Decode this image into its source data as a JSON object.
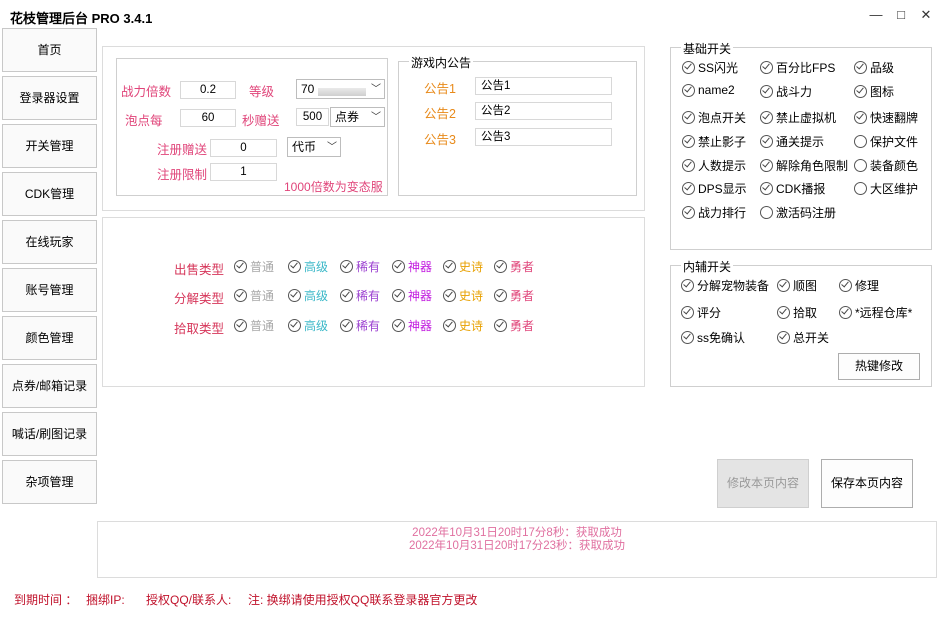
{
  "app": {
    "title": "花枝管理后台 PRO 3.4.1",
    "window_controls": {
      "minimize": "—",
      "maximize": "□",
      "close": "✕"
    }
  },
  "sidebar": {
    "items": [
      {
        "label": "首页"
      },
      {
        "label": "登录器设置"
      },
      {
        "label": "开关管理"
      },
      {
        "label": "CDK管理"
      },
      {
        "label": "在线玩家"
      },
      {
        "label": "账号管理"
      },
      {
        "label": "颜色管理"
      },
      {
        "label": "点券/邮箱记录"
      },
      {
        "label": "喊话/刷图记录"
      },
      {
        "label": "杂项管理"
      }
    ]
  },
  "settings": {
    "power_multiplier_label": "战力倍数",
    "power_multiplier_value": "0.2",
    "level_label": "等级",
    "level_value": "70",
    "bubble_label": "泡点每",
    "bubble_value": "60",
    "seconds_gift_label": "秒赠送",
    "seconds_gift_value": "500",
    "seconds_gift_currency": "点券",
    "register_gift_label": "注册赠送",
    "register_gift_value": "0",
    "register_gift_currency": "代币",
    "register_limit_label": "注册限制",
    "register_limit_value": "1",
    "note": "1000倍数为变态服"
  },
  "announcements": {
    "group_title": "游戏内公告",
    "items": [
      {
        "label": "公告1",
        "value": "公告1"
      },
      {
        "label": "公告2",
        "value": "公告2"
      },
      {
        "label": "公告3",
        "value": "公告3"
      }
    ]
  },
  "item_types": {
    "rows": [
      {
        "label": "出售类型"
      },
      {
        "label": "分解类型"
      },
      {
        "label": "拾取类型"
      }
    ],
    "grades": [
      {
        "label": "普通",
        "color": "#a8a8a8"
      },
      {
        "label": "高级",
        "color": "#3bb8c8"
      },
      {
        "label": "稀有",
        "color": "#9b3fd0"
      },
      {
        "label": "神器",
        "color": "#c21adf"
      },
      {
        "label": "史诗",
        "color": "#e8a000"
      },
      {
        "label": "勇者",
        "color": "#e0457a"
      }
    ]
  },
  "basic_switches": {
    "group_title": "基础开关",
    "items": [
      {
        "label": "SS闪光",
        "checked": true
      },
      {
        "label": "百分比FPS",
        "checked": true
      },
      {
        "label": "品级",
        "checked": true
      },
      {
        "label": "name2",
        "checked": true
      },
      {
        "label": "战斗力",
        "checked": true
      },
      {
        "label": "图标",
        "checked": true
      },
      {
        "label": "泡点开关",
        "checked": true
      },
      {
        "label": "禁止虚拟机",
        "checked": true
      },
      {
        "label": "快速翻牌",
        "checked": true
      },
      {
        "label": "禁止影子",
        "checked": true
      },
      {
        "label": "通关提示",
        "checked": true
      },
      {
        "label": "保护文件",
        "checked": false
      },
      {
        "label": "人数提示",
        "checked": true
      },
      {
        "label": "解除角色限制",
        "checked": true
      },
      {
        "label": "装备颜色",
        "checked": false
      },
      {
        "label": "DPS显示",
        "checked": true
      },
      {
        "label": "CDK播报",
        "checked": true
      },
      {
        "label": "大区维护",
        "checked": false
      },
      {
        "label": "战力排行",
        "checked": true
      },
      {
        "label": "激活码注册",
        "checked": false
      }
    ]
  },
  "aux_switches": {
    "group_title": "内辅开关",
    "items": [
      {
        "label": "分解宠物装备",
        "checked": true
      },
      {
        "label": "顺图",
        "checked": true
      },
      {
        "label": "修理",
        "checked": true
      },
      {
        "label": "评分",
        "checked": true
      },
      {
        "label": "拾取",
        "checked": true
      },
      {
        "label": "*远程仓库*",
        "checked": true
      },
      {
        "label": "ss免确认",
        "checked": true
      },
      {
        "label": "总开关",
        "checked": true
      }
    ],
    "hotkey_button": "热键修改"
  },
  "actions": {
    "modify_label": "修改本页内容",
    "save_label": "保存本页内容"
  },
  "log": {
    "lines": [
      "2022年10月31日20时17分8秒：获取成功",
      "2022年10月31日20时17分23秒：获取成功"
    ]
  },
  "footer": {
    "expire_label": "到期时间 ：",
    "bind_ip_label": "捆绑IP:",
    "auth_qq_label": "授权QQ/联系人:",
    "note": "注: 换绑请使用授权QQ联系登录器官方更改"
  }
}
